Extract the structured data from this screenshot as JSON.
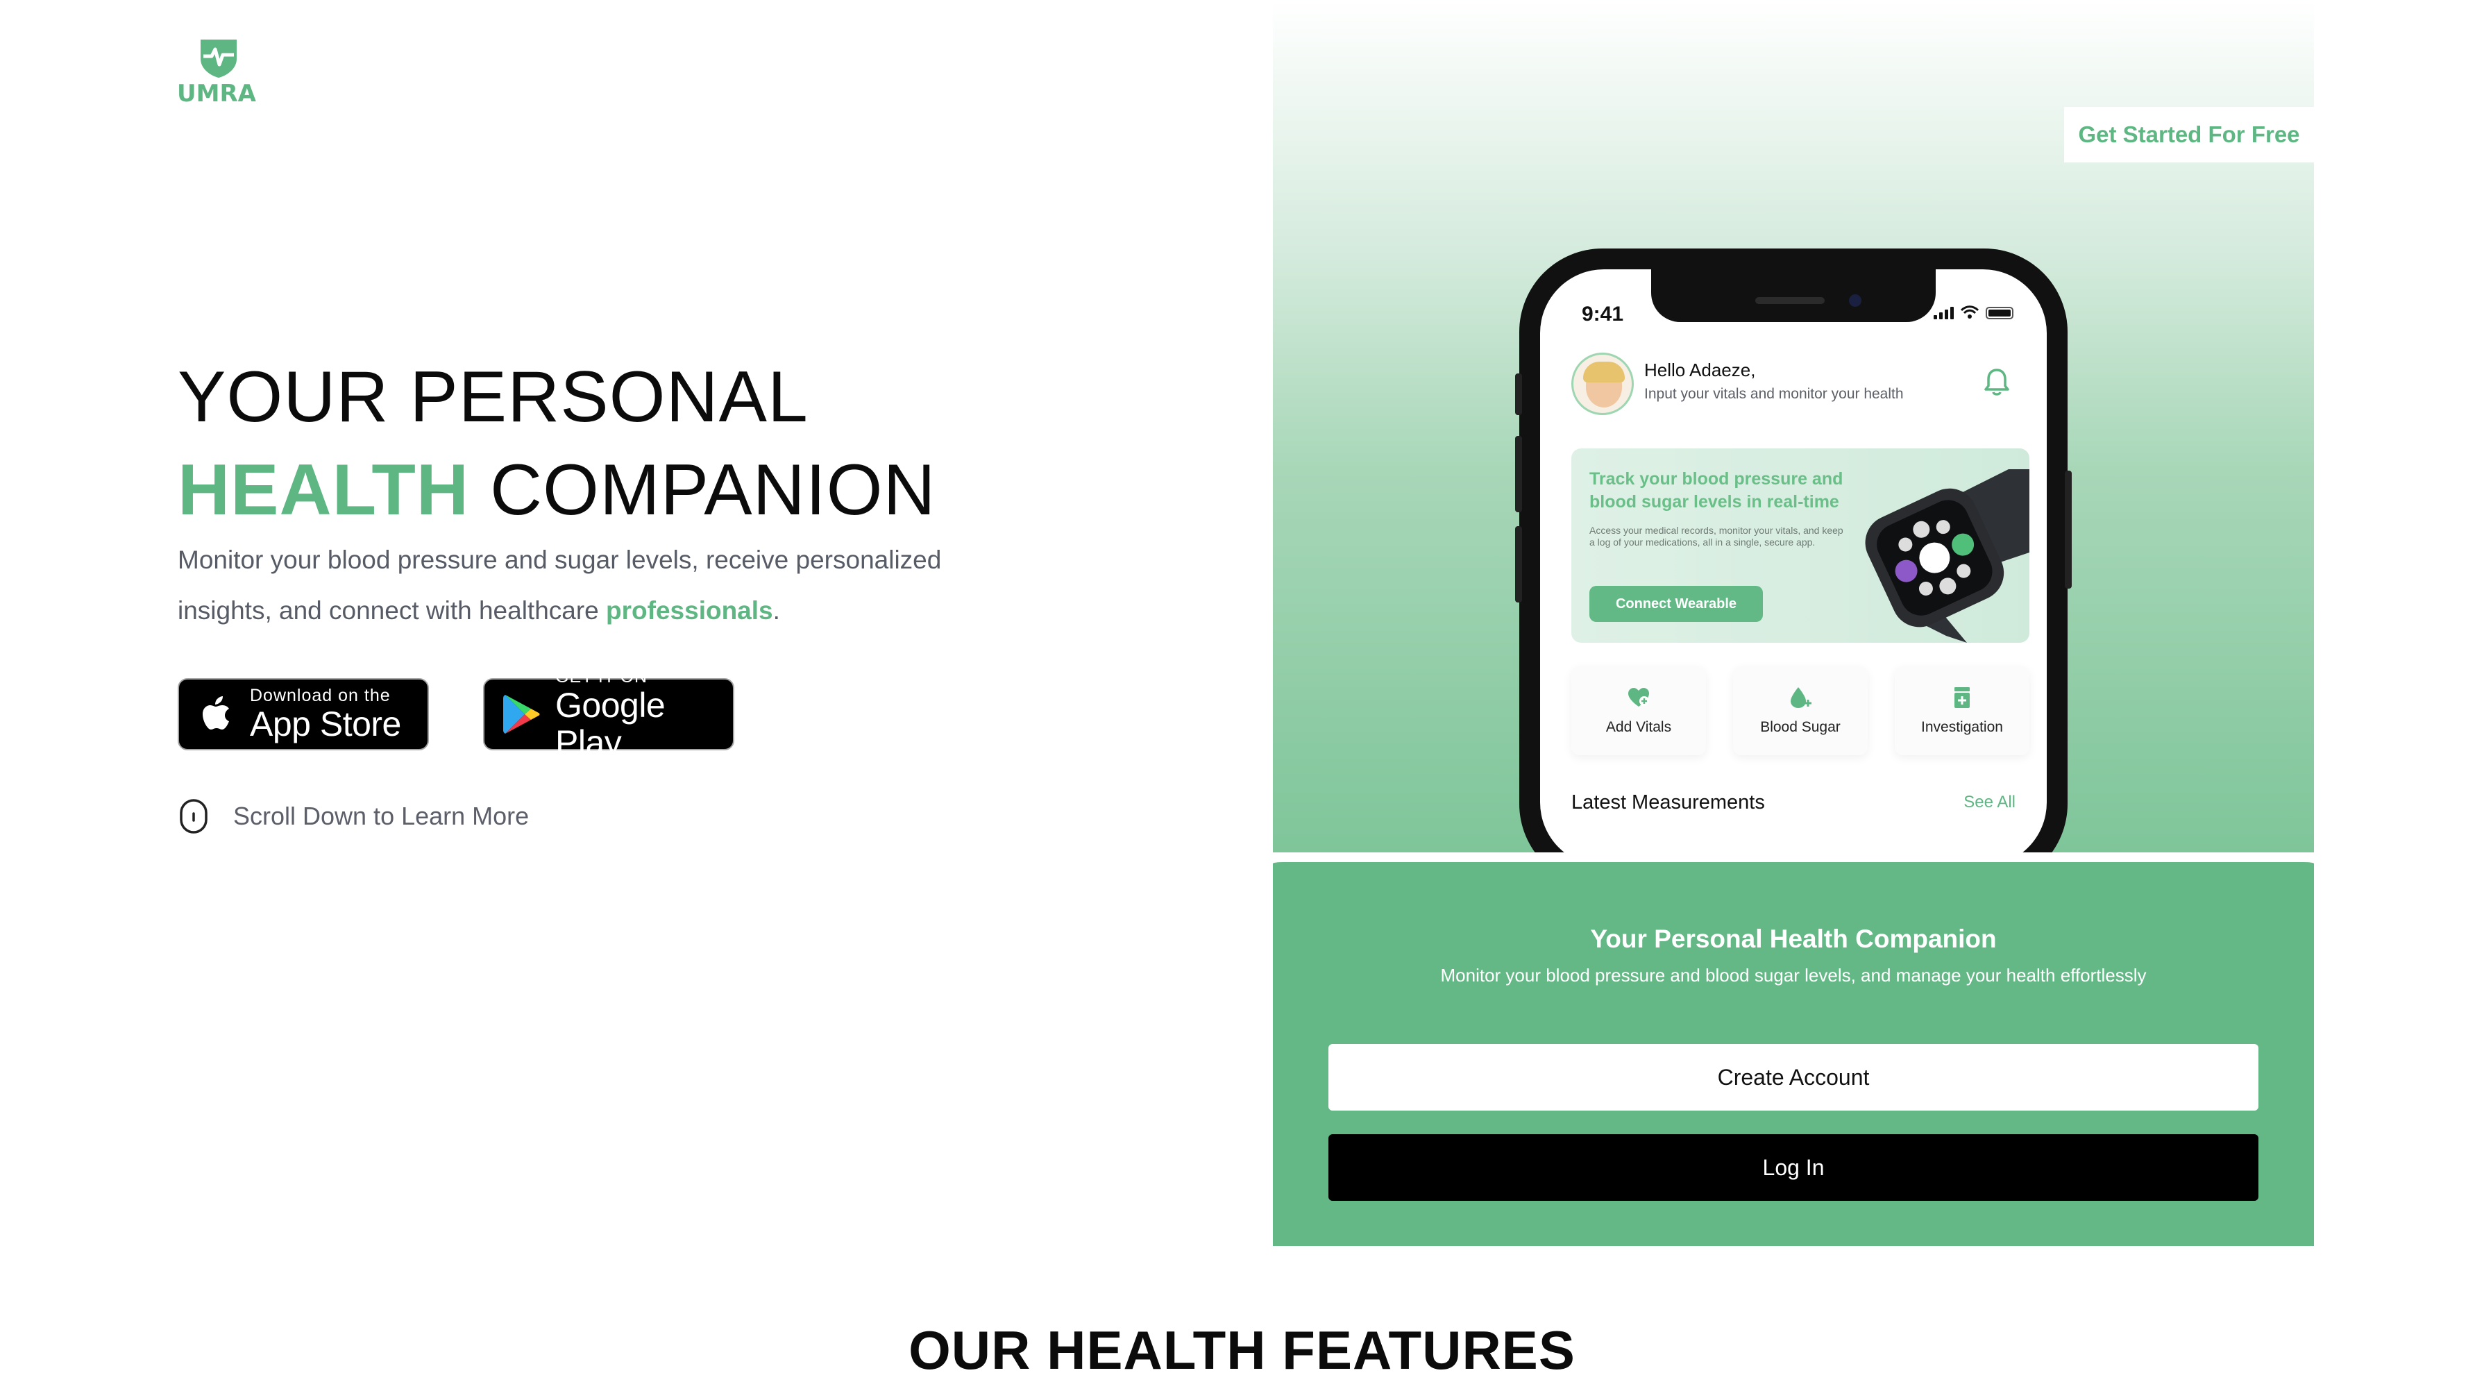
{
  "brand": {
    "name": "UMRA",
    "accent": "#5eb783"
  },
  "hero": {
    "title_line1": "YOUR PERSONAL",
    "title_accent": "HEALTH",
    "title_rest": "COMPANION",
    "desc_main": "Monitor your blood pressure and sugar levels, receive personalized insights, and connect with healthcare ",
    "desc_accent": "professionals",
    "desc_end": "."
  },
  "stores": {
    "appstore_small": "Download on the",
    "appstore_big": "App Store",
    "gplay_small": "GET IT ON",
    "gplay_big": "Google Play"
  },
  "scroll_hint": "Scroll Down to Learn More",
  "panel": {
    "get_started": "Get Started For Free",
    "phone": {
      "time": "9:41",
      "greeting": "Hello Adaeze,",
      "greeting_sub": "Input your vitals and monitor your health",
      "card_title": "Track your blood pressure and blood sugar levels in real-time",
      "card_desc": "Access your medical records, monitor your vitals, and keep a log of your medications, all in a single, secure app.",
      "card_button": "Connect Wearable",
      "tiles": [
        {
          "label": "Add Vitals",
          "icon": "heart-plus-icon"
        },
        {
          "label": "Blood Sugar",
          "icon": "drop-plus-icon"
        },
        {
          "label": "Investigation",
          "icon": "med-bottle-icon"
        }
      ],
      "latest_title": "Latest Measurements",
      "see_all": "See All"
    },
    "bottom_title": "Your Personal Health Companion",
    "bottom_sub": "Monitor your blood pressure and blood sugar levels, and manage your health effortlessly",
    "create_account": "Create Account",
    "log_in": "Log In"
  },
  "features_title": "OUR HEALTH FEATURES"
}
